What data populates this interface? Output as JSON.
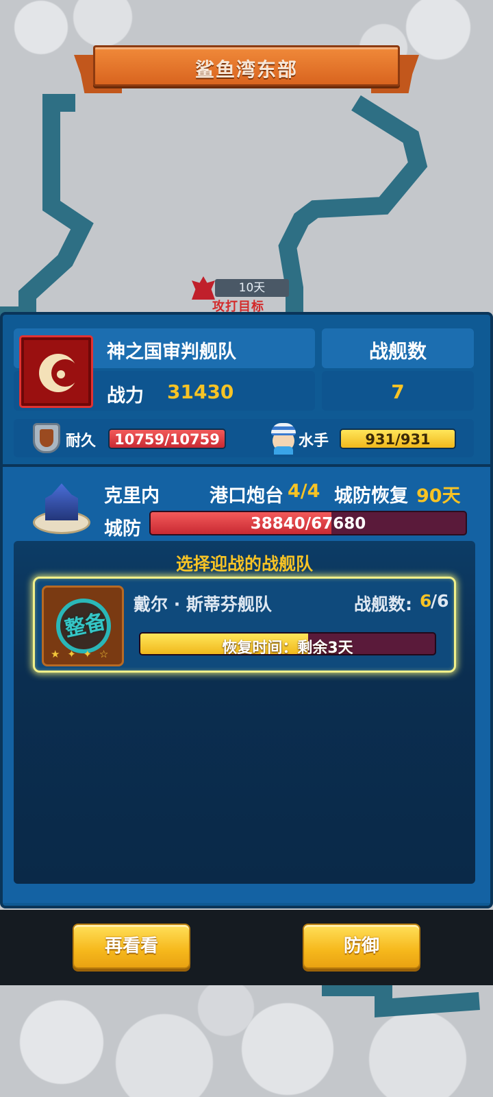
{
  "header": {
    "title": "鲨鱼湾东部"
  },
  "target_marker": {
    "days": "10天",
    "label": "攻打目标"
  },
  "attacking_fleet": {
    "name": "神之国审判舰队",
    "power_label": "战力",
    "power_value": "31430",
    "ships_label": "战舰数",
    "ships_value": "7",
    "durability_label": "耐久",
    "durability_text": "10759/10759",
    "durability_fraction": 1.0,
    "sailors_label": "水手",
    "sailors_text": "931/931",
    "sailors_fraction": 1.0,
    "icon": "crescent-emblem-icon"
  },
  "city": {
    "name": "克里内",
    "port_label": "港口炮台",
    "port_value": "4/4",
    "recover_label": "城防恢复",
    "recover_value": "90天",
    "defense_label": "城防",
    "defense_text": "38840/67680",
    "defense_fraction": 0.574
  },
  "selection": {
    "title": "选择迎战的战舰队",
    "fleets": [
      {
        "name": "戴尔 · 斯蒂芬舰队",
        "count_label": "战舰数:",
        "count_current": "6",
        "count_max": "/6",
        "status_stamp": "整备",
        "recovery_text": "恢复时间：剩余3天",
        "recovery_fraction": 0.57
      }
    ]
  },
  "actions": {
    "rethink_label": "再看看",
    "defend_label": "防御"
  },
  "colors": {
    "panel": "#0f5a94",
    "gold": "#f7c325",
    "red_bar": "#c92a33",
    "yellow_bar": "#f0b81c",
    "highlight": "#f1f08a"
  }
}
